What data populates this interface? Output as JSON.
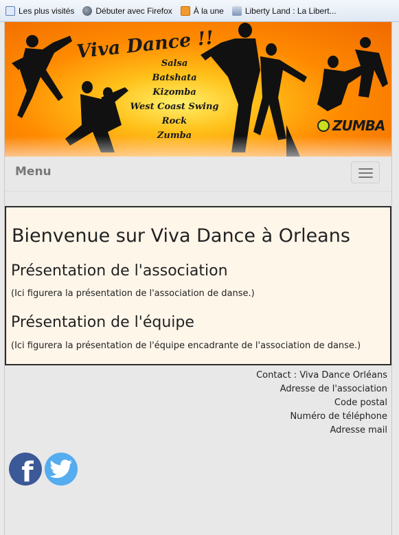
{
  "bookmarks": [
    {
      "label": "Les plus visités",
      "icon": "most-visited-icon"
    },
    {
      "label": "Débuter avec Firefox",
      "icon": "firefox-icon"
    },
    {
      "label": "À la une",
      "icon": "rss-icon"
    },
    {
      "label": "Liberty Land : La Libert...",
      "icon": "liberty-land-icon"
    }
  ],
  "banner": {
    "title": "Viva Dance !!",
    "dances": [
      "Salsa",
      "Batshata",
      "Kizomba",
      "West Coast Swing",
      "Rock",
      "Zumba"
    ],
    "zumba_logo": "ZUMBA",
    "colors": {
      "outer": "#f06a00",
      "inner": "#ffef6a"
    }
  },
  "navbar": {
    "menu_label": "Menu",
    "toggle_icon": "hamburger-icon"
  },
  "content": {
    "title": "Bienvenue sur Viva Dance à Orleans",
    "sections": [
      {
        "heading": "Présentation de l'association",
        "text": "(Ici figurera la présentation de l'association de danse.)"
      },
      {
        "heading": "Présentation de l'équipe",
        "text": "(Ici figurera la présentation de l'équipe encadrante de l'association de danse.)"
      }
    ]
  },
  "contact": {
    "lines": [
      "Contact : Viva Dance Orléans",
      "Adresse de l'association",
      "Code postal",
      "Numéro de téléphone",
      "Adresse mail"
    ]
  },
  "social": [
    {
      "name": "facebook-icon",
      "color": "#3b5897"
    },
    {
      "name": "twitter-icon",
      "color": "#55acee"
    }
  ]
}
